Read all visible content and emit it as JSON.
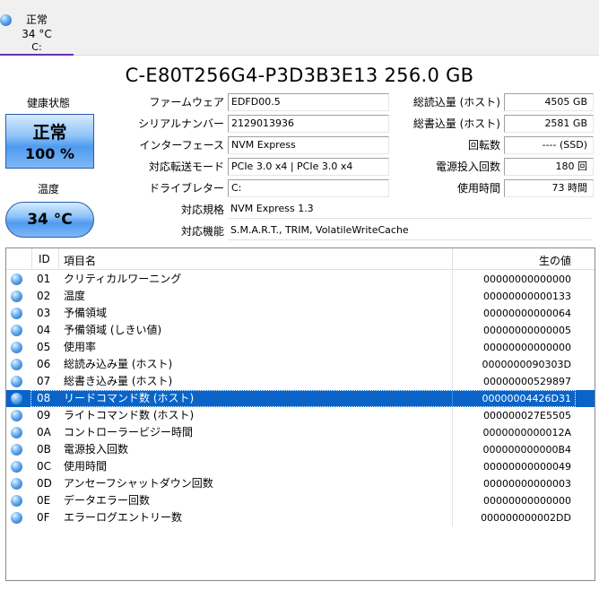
{
  "drive_tab": {
    "status": "正常",
    "temperature": "34 °C",
    "letter": "C:"
  },
  "title": "C-E80T256G4-P3D3B3E13 256.0 GB",
  "health": {
    "label": "健康状態",
    "status": "正常",
    "percent": "100 %"
  },
  "temperature": {
    "label": "温度",
    "value": "34 °C"
  },
  "info_left": [
    {
      "label": "ファームウェア",
      "value": "EDFD00.5"
    },
    {
      "label": "シリアルナンバー",
      "value": "2129013936"
    },
    {
      "label": "インターフェース",
      "value": "NVM Express"
    },
    {
      "label": "対応転送モード",
      "value": "PCIe 3.0 x4 | PCIe 3.0 x4"
    },
    {
      "label": "ドライブレター",
      "value": "C:"
    },
    {
      "label": "対応規格",
      "value": "NVM Express 1.3"
    },
    {
      "label": "対応機能",
      "value": "S.M.A.R.T., TRIM, VolatileWriteCache"
    }
  ],
  "info_right": [
    {
      "label": "総読込量 (ホスト)",
      "value": "4505 GB"
    },
    {
      "label": "総書込量 (ホスト)",
      "value": "2581 GB"
    },
    {
      "label": "回転数",
      "value": "---- (SSD)"
    },
    {
      "label": "電源投入回数",
      "value": "180 回"
    },
    {
      "label": "使用時間",
      "value": "73 時間"
    }
  ],
  "table": {
    "headers": {
      "id": "ID",
      "name": "項目名",
      "raw": "生の値"
    },
    "rows": [
      {
        "id": "01",
        "name": "クリティカルワーニング",
        "raw": "00000000000000"
      },
      {
        "id": "02",
        "name": "温度",
        "raw": "00000000000133"
      },
      {
        "id": "03",
        "name": "予備領域",
        "raw": "00000000000064"
      },
      {
        "id": "04",
        "name": "予備領域 (しきい値)",
        "raw": "00000000000005"
      },
      {
        "id": "05",
        "name": "使用率",
        "raw": "00000000000000"
      },
      {
        "id": "06",
        "name": "総読み込み量 (ホスト)",
        "raw": "0000000090303D"
      },
      {
        "id": "07",
        "name": "総書き込み量 (ホスト)",
        "raw": "00000000529897"
      },
      {
        "id": "08",
        "name": "リードコマンド数 (ホスト)",
        "raw": "00000004426D31"
      },
      {
        "id": "09",
        "name": "ライトコマンド数 (ホスト)",
        "raw": "000000027E5505"
      },
      {
        "id": "0A",
        "name": "コントローラービジー時間",
        "raw": "0000000000012A"
      },
      {
        "id": "0B",
        "name": "電源投入回数",
        "raw": "000000000000B4"
      },
      {
        "id": "0C",
        "name": "使用時間",
        "raw": "00000000000049"
      },
      {
        "id": "0D",
        "name": "アンセーフシャットダウン回数",
        "raw": "00000000000003"
      },
      {
        "id": "0E",
        "name": "データエラー回数",
        "raw": "00000000000000"
      },
      {
        "id": "0F",
        "name": "エラーログエントリー数",
        "raw": "000000000002DD"
      }
    ]
  },
  "colors": {
    "selection": "#0a64c8",
    "accent": "#6a2fb5",
    "status_blue": "#4f9af0"
  }
}
